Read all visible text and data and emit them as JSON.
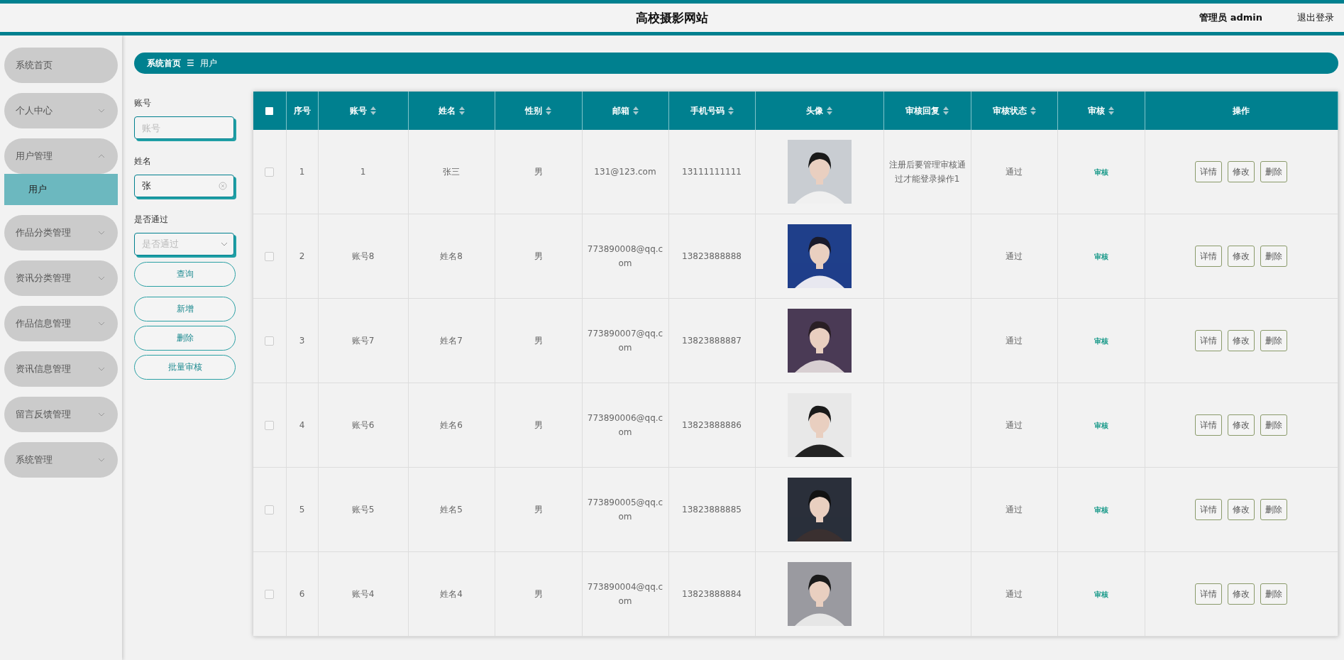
{
  "header": {
    "title": "高校摄影网站",
    "user": "管理员 admin",
    "logout": "退出登录"
  },
  "sidebar": {
    "items": [
      {
        "label": "系统首页",
        "kind": "link"
      },
      {
        "label": "个人中心",
        "kind": "menu",
        "expanded": false
      },
      {
        "label": "用户管理",
        "kind": "menu",
        "expanded": true,
        "children": [
          {
            "label": "用户",
            "selected": true
          }
        ]
      },
      {
        "label": "作品分类管理",
        "kind": "menu",
        "expanded": false
      },
      {
        "label": "资讯分类管理",
        "kind": "menu",
        "expanded": false
      },
      {
        "label": "作品信息管理",
        "kind": "menu",
        "expanded": false
      },
      {
        "label": "资讯信息管理",
        "kind": "menu",
        "expanded": false
      },
      {
        "label": "留言反馈管理",
        "kind": "menu",
        "expanded": false
      },
      {
        "label": "系统管理",
        "kind": "menu",
        "expanded": false
      }
    ]
  },
  "breadcrumb": {
    "home": "系统首页",
    "separator": "☰",
    "current": "用户"
  },
  "filters": [
    {
      "label": "账号",
      "kind": "text",
      "placeholder": "账号"
    },
    {
      "label": "姓名",
      "kind": "text",
      "value": "张"
    },
    {
      "label": "是否通过",
      "kind": "select",
      "placeholder": "是否通过"
    }
  ],
  "buttons": [
    {
      "label": "查询",
      "kind": "search"
    },
    {
      "label": "新增",
      "kind": "action"
    },
    {
      "label": "删除",
      "kind": "action"
    },
    {
      "label": "批量审核",
      "kind": "action"
    }
  ],
  "table": {
    "select_all_checked": false,
    "columns": [
      {
        "label": "序号",
        "sortable": false
      },
      {
        "label": "账号",
        "sortable": true
      },
      {
        "label": "姓名",
        "sortable": true
      },
      {
        "label": "性别",
        "sortable": true
      },
      {
        "label": "邮箱",
        "sortable": true
      },
      {
        "label": "手机号码",
        "sortable": true
      },
      {
        "label": "头像",
        "sortable": true
      },
      {
        "label": "审核回复",
        "sortable": true
      },
      {
        "label": "审核状态",
        "sortable": true
      },
      {
        "label": "审核",
        "sortable": true
      },
      {
        "label": "操作",
        "sortable": false
      }
    ],
    "rows": [
      {
        "checked": false,
        "index": "1",
        "account": "1",
        "name": "张三",
        "gender": "男",
        "email": "131@123.com",
        "phone": "13111111111",
        "avatar": {
          "kind": "picture"
        },
        "reply": "注册后要管理审核通过才能登录操作1",
        "status": "通过",
        "review": "审核",
        "actions": [
          "详情",
          "修改",
          "删除"
        ]
      },
      {
        "checked": false,
        "index": "2",
        "account": "账号8",
        "name": "姓名8",
        "gender": "男",
        "email": "773890008@qq.com",
        "phone": "13823888888",
        "avatar": {
          "kind": "picture"
        },
        "status": "通过",
        "review": "审核",
        "actions": [
          "详情",
          "修改",
          "删除"
        ]
      },
      {
        "checked": false,
        "index": "3",
        "account": "账号7",
        "name": "姓名7",
        "gender": "男",
        "email": "773890007@qq.com",
        "phone": "13823888887",
        "avatar": {
          "kind": "picture"
        },
        "status": "通过",
        "review": "审核",
        "actions": [
          "详情",
          "修改",
          "删除"
        ]
      },
      {
        "checked": false,
        "index": "4",
        "account": "账号6",
        "name": "姓名6",
        "gender": "男",
        "email": "773890006@qq.com",
        "phone": "13823888886",
        "avatar": {
          "kind": "picture"
        },
        "status": "通过",
        "review": "审核",
        "actions": [
          "详情",
          "修改",
          "删除"
        ]
      },
      {
        "checked": false,
        "index": "5",
        "account": "账号5",
        "name": "姓名5",
        "gender": "男",
        "email": "773890005@qq.com",
        "phone": "13823888885",
        "avatar": {
          "kind": "picture"
        },
        "status": "通过",
        "review": "审核",
        "actions": [
          "详情",
          "修改",
          "删除"
        ]
      },
      {
        "checked": false,
        "index": "6",
        "account": "账号4",
        "name": "姓名4",
        "gender": "男",
        "email": "773890004@qq.com",
        "phone": "13823888884",
        "avatar": {
          "kind": "picture"
        },
        "status": "通过",
        "review": "审核",
        "actions": [
          "详情",
          "修改",
          "删除"
        ]
      }
    ]
  }
}
